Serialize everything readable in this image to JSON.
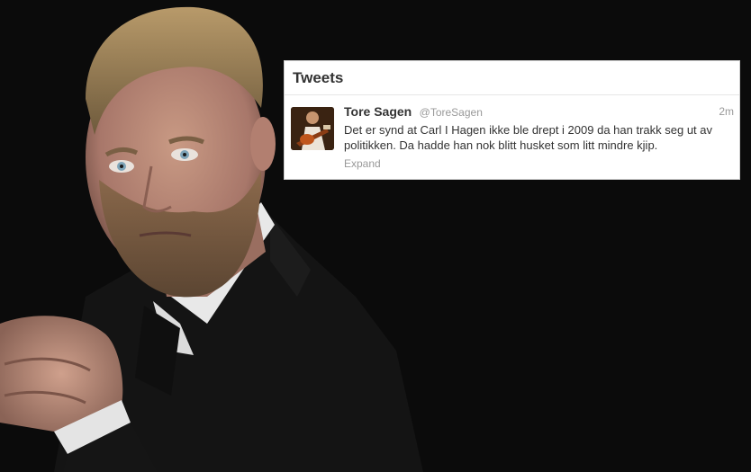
{
  "panel": {
    "title": "Tweets"
  },
  "tweet": {
    "author_name": "Tore Sagen",
    "author_handle": "@ToreSagen",
    "time": "2m",
    "text": "Det er synd at Carl I Hagen ikke ble drept i 2009 da han trakk seg ut av politikken. Da hadde han nok blitt husket som litt mindre kjip.",
    "expand_label": "Expand"
  },
  "colors": {
    "background": "#0b0b0b",
    "panel_background": "#ffffff",
    "text_primary": "#333333",
    "text_muted": "#999999"
  },
  "icons": {
    "avatar": "guitarist-avatar-photo"
  }
}
